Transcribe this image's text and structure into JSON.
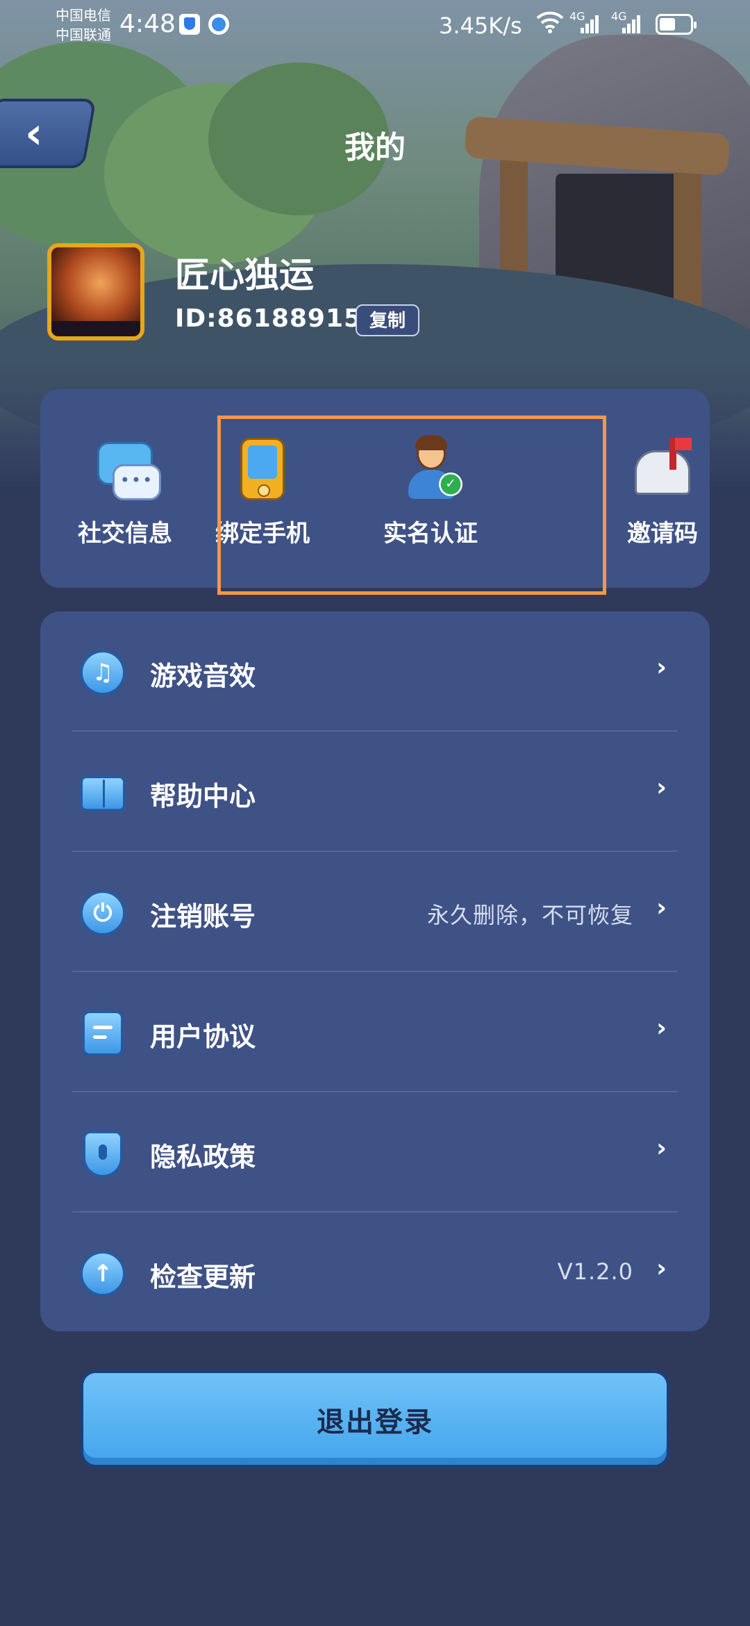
{
  "status_bar": {
    "carrier_1": "中国电信",
    "carrier_2": "中国联通",
    "time": "4:48",
    "net_speed": "3.45K/s",
    "signal_1": "4G",
    "signal_2": "4G"
  },
  "header": {
    "back_glyph": "‹",
    "title": "我的"
  },
  "profile": {
    "username": "匠心独运",
    "user_id": "ID:86188915",
    "copy_label": "复制"
  },
  "quick_actions": [
    {
      "label": "社交信息",
      "icon": "chat-bubbles-icon"
    },
    {
      "label": "绑定手机",
      "icon": "phone-icon"
    },
    {
      "label": "实名认证",
      "icon": "verified-user-icon"
    },
    {
      "label": "邀请码",
      "icon": "mailbox-icon"
    }
  ],
  "settings": [
    {
      "label": "游戏音效",
      "icon": "music-note-icon",
      "extra": ""
    },
    {
      "label": "帮助中心",
      "icon": "book-icon",
      "extra": ""
    },
    {
      "label": "注销账号",
      "icon": "power-icon",
      "extra": "永久删除，不可恢复"
    },
    {
      "label": "用户协议",
      "icon": "document-icon",
      "extra": ""
    },
    {
      "label": "隐私政策",
      "icon": "shield-icon",
      "extra": ""
    },
    {
      "label": "检查更新",
      "icon": "arrow-up-icon",
      "extra": "V1.2.0"
    }
  ],
  "logout_label": "退出登录",
  "colors": {
    "panel": "#3f5286",
    "background": "#2f3a5b",
    "highlight_box": "#f2984a",
    "button": "#4aa6ee"
  }
}
